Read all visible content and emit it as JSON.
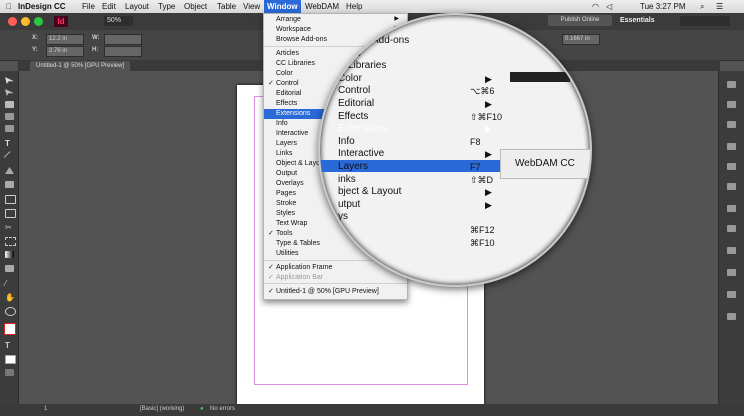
{
  "menubar": {
    "app_name": "InDesign CC",
    "items": [
      "File",
      "Edit",
      "Layout",
      "Type",
      "Object",
      "Table",
      "View",
      "Window",
      "WebDAM",
      "Help"
    ],
    "clock": "Tue 3:27 PM"
  },
  "appbar": {
    "zoom": "50%",
    "publish": "Publish Online",
    "workspace": "Essentials"
  },
  "toolbar": {
    "x_label": "X:",
    "x_value": "12.2 in",
    "y_label": "Y:",
    "y_value": "2.76 in",
    "w_label": "W:",
    "h_label": "H:",
    "stroke_value": "0.1667 in"
  },
  "doc_tab": "Untitled-1 @ 50% [GPU Preview]",
  "window_menu": {
    "items": [
      {
        "label": "Arrange",
        "arrow": true
      },
      {
        "label": "Workspace",
        "arrow": true
      },
      {
        "label": "Browse Add-ons"
      },
      {
        "label": "Articles"
      },
      {
        "label": "CC Libraries"
      },
      {
        "label": "Color",
        "arrow": true
      },
      {
        "label": "Control",
        "check": true
      },
      {
        "label": "Editorial"
      },
      {
        "label": "Effects"
      },
      {
        "label": "Extensions",
        "highlight": true,
        "arrow": true
      },
      {
        "label": "Info"
      },
      {
        "label": "Interactive",
        "arrow": true
      },
      {
        "label": "Layers"
      },
      {
        "label": "Links"
      },
      {
        "label": "Object & Layout",
        "arrow": true
      },
      {
        "label": "Output",
        "arrow": true
      },
      {
        "label": "Overlays"
      },
      {
        "label": "Pages"
      },
      {
        "label": "Stroke"
      },
      {
        "label": "Styles",
        "arrow": true
      },
      {
        "label": "Text Wrap"
      },
      {
        "label": "Tools",
        "check": true
      },
      {
        "label": "Type & Tables",
        "arrow": true
      },
      {
        "label": "Utilities",
        "arrow": true
      },
      {
        "label": "Application Frame",
        "check": true
      },
      {
        "label": "Application Bar",
        "check": true,
        "disabled": true
      },
      {
        "label": "Untitled-1 @ 50% [GPU Preview]",
        "check": true
      }
    ]
  },
  "magnifier": {
    "rows": [
      {
        "label": "Add-ons"
      },
      {
        "label": "ticles"
      },
      {
        "label": "C Libraries"
      },
      {
        "label": "Color",
        "arrow": "▶"
      },
      {
        "label": "Control",
        "shortcut": "⌥⌘6"
      },
      {
        "label": "Editorial",
        "arrow": "▶"
      },
      {
        "label": "Effects",
        "shortcut": "⇧⌘F10"
      },
      {
        "label": "Extensions",
        "arrow": "▶",
        "highlight": true
      },
      {
        "label": "Info",
        "shortcut": "F8"
      },
      {
        "label": "Interactive",
        "arrow": "▶"
      },
      {
        "label": "Layers",
        "shortcut": "F7"
      },
      {
        "label": "inks",
        "shortcut": "⇧⌘D"
      },
      {
        "label": "bject & Layout",
        "arrow": "▶"
      },
      {
        "label": "utput",
        "arrow": "▶"
      },
      {
        "label": "ys"
      },
      {
        "label": "",
        "shortcut": "⌘F12"
      },
      {
        "label": "",
        "shortcut": "⌘F10"
      }
    ],
    "submenu_item": "WebDAM CC"
  },
  "status": {
    "page": "1",
    "style": "[Basic] (working)",
    "errors": "No errors"
  },
  "colors": {
    "highlight": "#2a69d8",
    "app_bg": "#535353",
    "guide": "#e08ee0",
    "id_logo": "#ff3366"
  }
}
